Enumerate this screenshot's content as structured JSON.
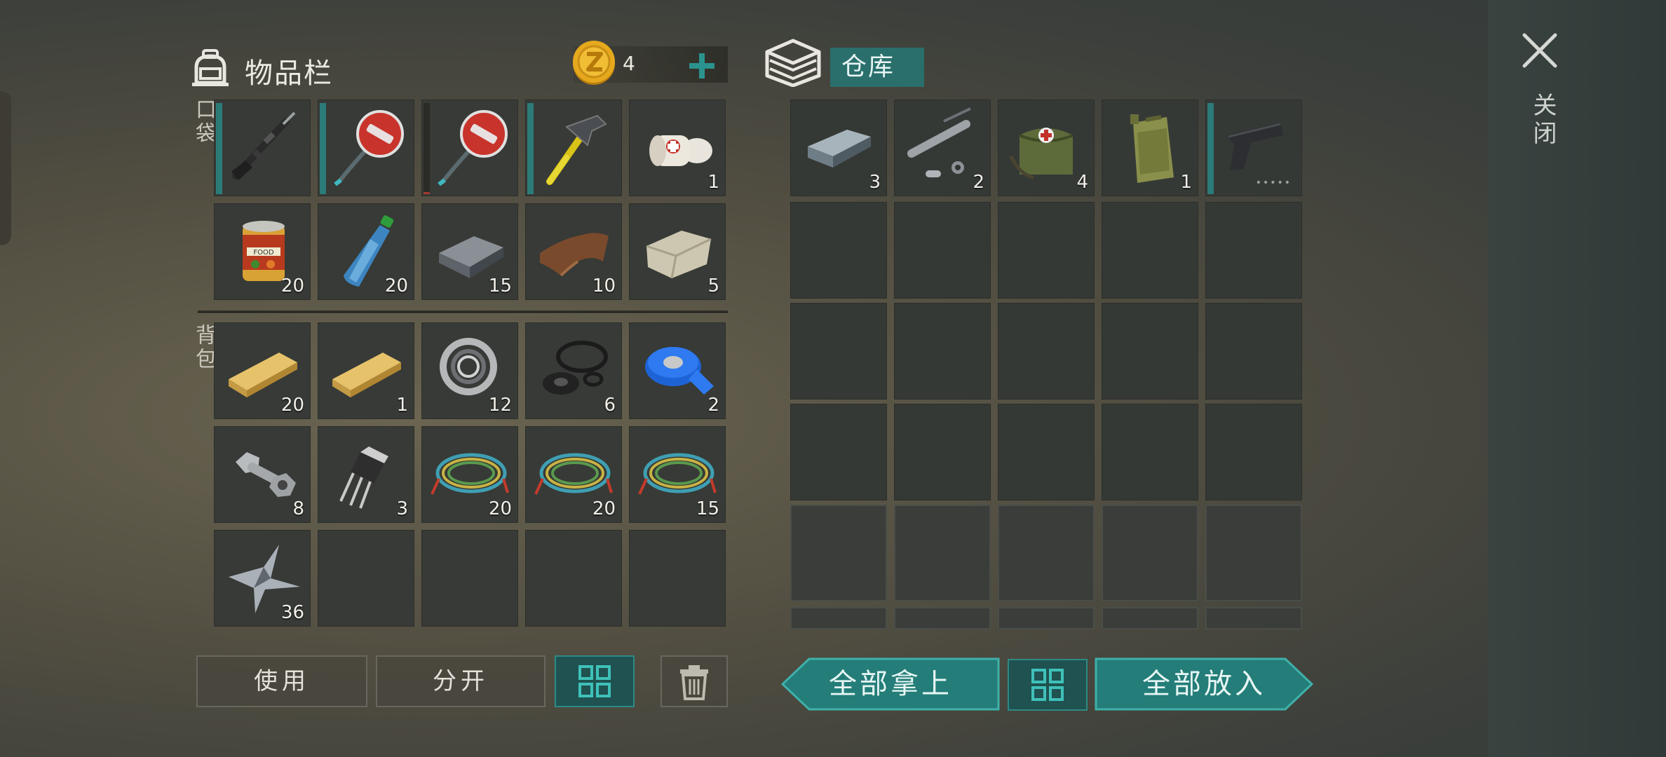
{
  "inventory": {
    "title": "物品栏",
    "coins": "4",
    "pocket_label": "口袋",
    "backpack_label": "背包",
    "pocket_slots": [
      {
        "icon": "rifle-icon",
        "qty": "",
        "equipped": true
      },
      {
        "icon": "stop-sign-icon",
        "qty": "",
        "equipped": true
      },
      {
        "icon": "stop-sign-icon",
        "qty": "",
        "equipped": false
      },
      {
        "icon": "hammer-icon",
        "qty": "",
        "equipped": true
      },
      {
        "icon": "bandage-icon",
        "qty": "1",
        "equipped": false
      },
      {
        "icon": "food-can-icon",
        "qty": "20",
        "equipped": false
      },
      {
        "icon": "water-bottle-icon",
        "qty": "20",
        "equipped": false
      },
      {
        "icon": "iron-bar-icon",
        "qty": "15",
        "equipped": false
      },
      {
        "icon": "leather-icon",
        "qty": "10",
        "equipped": false
      },
      {
        "icon": "stone-icon",
        "qty": "5",
        "equipped": false
      }
    ],
    "backpack_slots": [
      {
        "icon": "wood-plank-icon",
        "qty": "20"
      },
      {
        "icon": "wood-plank-icon",
        "qty": "1"
      },
      {
        "icon": "bearing-icon",
        "qty": "12"
      },
      {
        "icon": "rubber-parts-icon",
        "qty": "6"
      },
      {
        "icon": "tape-icon",
        "qty": "2"
      },
      {
        "icon": "bolt-nut-icon",
        "qty": "8"
      },
      {
        "icon": "transistor-icon",
        "qty": "3"
      },
      {
        "icon": "wire-icon",
        "qty": "20"
      },
      {
        "icon": "wire-icon",
        "qty": "20"
      },
      {
        "icon": "wire-icon",
        "qty": "15"
      },
      {
        "icon": "scrap-metal-icon",
        "qty": "36"
      },
      {
        "icon": "",
        "qty": ""
      },
      {
        "icon": "",
        "qty": ""
      },
      {
        "icon": "",
        "qty": ""
      },
      {
        "icon": "",
        "qty": ""
      }
    ]
  },
  "warehouse": {
    "title": "仓库",
    "slots": [
      {
        "icon": "iron-ingot-icon",
        "qty": "3"
      },
      {
        "icon": "pipe-parts-icon",
        "qty": "2"
      },
      {
        "icon": "medkit-bag-icon",
        "qty": "4"
      },
      {
        "icon": "jerrycan-icon",
        "qty": "1"
      },
      {
        "icon": "pistol-icon",
        "qty": "",
        "equipped": true,
        "durability": "•••••"
      }
    ]
  },
  "buttons": {
    "use": "使用",
    "split": "分开",
    "take_all": "全部拿上",
    "put_all": "全部放入",
    "close": "关闭"
  },
  "colors": {
    "accent": "#2a6f6c",
    "coin": "#e0a21a"
  }
}
